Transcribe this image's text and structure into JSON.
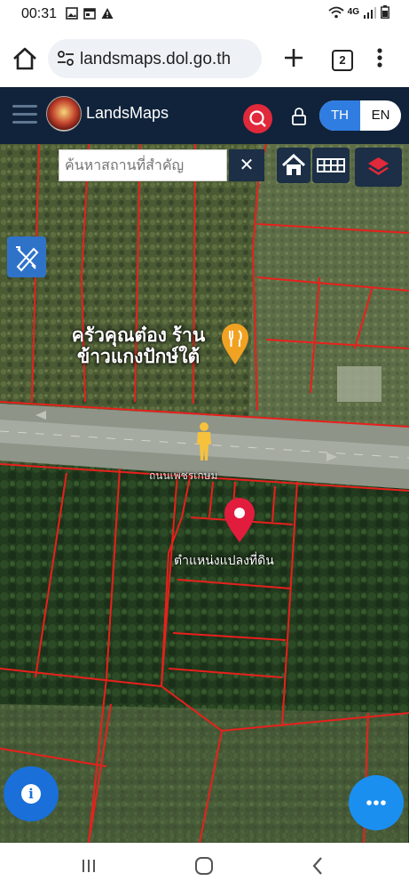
{
  "status_bar": {
    "time": "00:31",
    "network": "4G"
  },
  "browser": {
    "url": "landsmaps.dol.go.th",
    "tab_count": "2"
  },
  "app": {
    "brand": "LandsMaps",
    "lang_th": "TH",
    "lang_en": "EN"
  },
  "map": {
    "search": {
      "placeholder": "ค้นหาสถานที่สำคัญ"
    },
    "clear_label": "✕",
    "poi": {
      "line1": "ครัวคุณต๋อง ร้าน",
      "line2": "ข้าวแกงปักษ์ใต้"
    },
    "road_label": "ถนนเพชรเกษม",
    "parcel_label": "ตำแหน่งแปลงที่ดิน"
  },
  "colors": {
    "app_bar": "#10233b",
    "accent_red": "#e0293a",
    "lang_active": "#2f7de1",
    "parcel_line": "#e8201c"
  }
}
